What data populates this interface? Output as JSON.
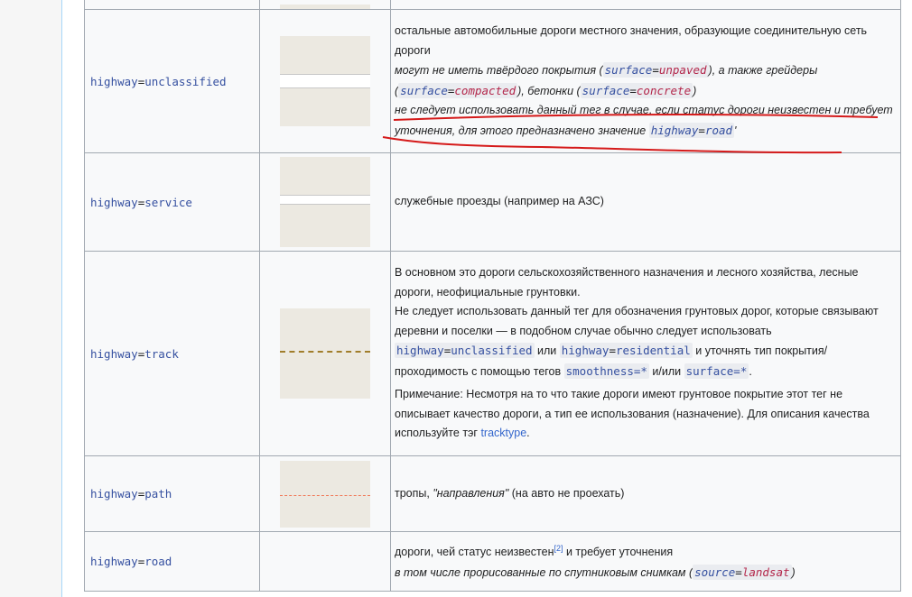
{
  "colors": {
    "tag_key": "#3550a0",
    "tag_value_red": "#b3264a",
    "link": "#3366cc",
    "annotation": "#d51a1a",
    "swatch_bg": "#ece9e1"
  },
  "rows": [
    {
      "tag_key": "highway",
      "tag_eq": "=",
      "tag_value": "unclassified",
      "desc_line1": "остальные автомобильные дороги местного значения, образующие соединительную сеть дороги",
      "desc_italic_a": "могут не иметь твёрдого покрытия (",
      "c1_key": "surface",
      "c1_eq": "=",
      "c1_val": "unpaved",
      "desc_italic_b": "), а также грейдеры (",
      "c2_key": "surface",
      "c2_eq": "=",
      "c2_val": "compacted",
      "desc_italic_c": "), бетонки (",
      "c3_key": "surface",
      "c3_eq": "=",
      "c3_val": "concrete",
      "desc_italic_d": ")",
      "desc_note": "не следует использовать данный тег в случае, если статус дороги неизвестен и требует уточнения, для этого предназначено значение ",
      "note_key": "highway",
      "note_eq": "=",
      "note_val": "road",
      "note_end": "'"
    },
    {
      "tag_key": "highway",
      "tag_eq": "=",
      "tag_value": "service",
      "desc": "служебные проезды (например на АЗС)"
    },
    {
      "tag_key": "highway",
      "tag_eq": "=",
      "tag_value": "track",
      "p1": "В основном это дороги сельскохозяйственного назначения и лесного хозяйства, лесные дороги, неофициальные грунтовки.",
      "p2a": "Не следует использовать данный тег для обозначения грунтовых дорог, которые связывают деревни и поселки — в подобном случае обычно следует использовать ",
      "i1_key": "highway",
      "i1_eq": "=",
      "i1_val": "unclassified",
      "p2b": " или ",
      "i2_key": "highway",
      "i2_eq": "=",
      "i2_val": "residential",
      "p2c": " и уточнять тип покрытия/проходимость с помощью тегов ",
      "i3": "smoothness=*",
      "p2d": " и/или ",
      "i4": "surface=*",
      "p2e": ".",
      "p3a": "Примечание: Несмотря на то что такие дороги имеют грунтовое покрытие этот тег не описывает качество дороги, а тип ее использования (назначение). Для описания качества используйте тэг ",
      "p3_link": "tracktype",
      "p3b": "."
    },
    {
      "tag_key": "highway",
      "tag_eq": "=",
      "tag_value": "path",
      "desc_a": "тропы, ",
      "desc_italic": "\"направления\"",
      "desc_b": " (на авто не проехать)"
    },
    {
      "tag_key": "highway",
      "tag_eq": "=",
      "tag_value": "road",
      "desc_a": "дороги, чей статус неизвестен",
      "ref": "[2]",
      "desc_b": " и требует уточнения",
      "italic_a": "в том числе прорисованные по спутниковым снимкам (",
      "src_key": "source",
      "src_eq": "=",
      "src_val": "landsat",
      "italic_b": ")"
    }
  ]
}
